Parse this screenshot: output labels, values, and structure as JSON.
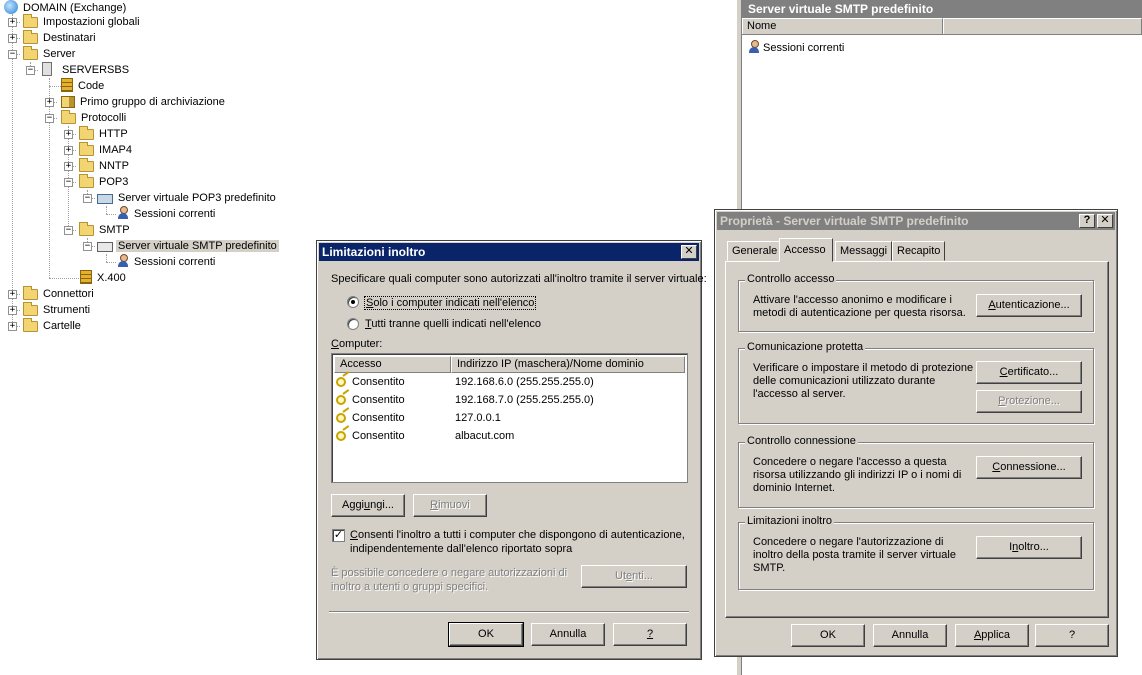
{
  "tree": {
    "root": "DOMAIN (Exchange)",
    "impostazioni": "Impostazioni globali",
    "destinatari": "Destinatari",
    "server": "Server",
    "serversbs": "SERVERSBS",
    "code": "Code",
    "primo_gruppo": "Primo gruppo di archiviazione",
    "protocolli": "Protocolli",
    "http": "HTTP",
    "imap4": "IMAP4",
    "nntp": "NNTP",
    "pop3": "POP3",
    "pop3_vs": "Server virtuale POP3 predefinito",
    "sessioni_pop3": "Sessioni correnti",
    "smtp": "SMTP",
    "smtp_vs": "Server virtuale SMTP predefinito",
    "sessioni_smtp": "Sessioni correnti",
    "x400": "X.400",
    "connettori": "Connettori",
    "strumenti": "Strumenti",
    "cartelle": "Cartelle"
  },
  "right_pane": {
    "title": "Server virtuale SMTP predefinito",
    "col_name": "Nome",
    "item": "Sessioni correnti"
  },
  "relay_dialog": {
    "title": "Limitazioni inoltro",
    "close": "✕",
    "intro": "Specificare quali computer sono autorizzati all'inoltro tramite il server virtuale:",
    "opt_only_pre": "",
    "opt_only_u": "S",
    "opt_only_post": "olo i computer indicati nell'elenco",
    "opt_all_u": "T",
    "opt_all_post": "utti tranne quelli indicati nell'elenco",
    "computer_u": "C",
    "computer_post": "omputer:",
    "col_access": "Accesso",
    "col_ip": "Indirizzo IP (maschera)/Nome dominio",
    "rows": [
      {
        "access": "Consentito",
        "ip": "192.168.6.0 (255.255.255.0)"
      },
      {
        "access": "Consentito",
        "ip": "192.168.7.0 (255.255.255.0)"
      },
      {
        "access": "Consentito",
        "ip": "127.0.0.1"
      },
      {
        "access": "Consentito",
        "ip": "albacut.com"
      }
    ],
    "add_pre": "Aggi",
    "add_u": "u",
    "add_post": "ngi...",
    "remove_u": "R",
    "remove_post": "imuovi",
    "check_mark": "✓",
    "allow_auth_u": "C",
    "allow_auth_post": "onsenti l'inoltro a tutti i computer che dispongono di autenticazione,",
    "allow_auth_line2": "indipendentemente dall'elenco riportato sopra",
    "note_line1": "È possibile concedere o negare autorizzazioni di",
    "note_line2": "inoltro a utenti o gruppi specifici.",
    "users_pre": "Ut",
    "users_u": "e",
    "users_post": "nti...",
    "ok": "OK",
    "cancel": "Annulla",
    "help": "?"
  },
  "props_dialog": {
    "title": "Proprietà - Server virtuale SMTP predefinito",
    "help_btn": "?",
    "close": "✕",
    "tabs": [
      "Generale",
      "Accesso",
      "Messaggi",
      "Recapito"
    ],
    "groups": {
      "access_control": {
        "title": "Controllo accesso",
        "line1": "Attivare l'accesso anonimo e modificare i",
        "line2": "metodi di autenticazione per questa risorsa.",
        "btn_u": "A",
        "btn_post": "utenticazione..."
      },
      "secure_comm": {
        "title": "Comunicazione protetta",
        "line1": "Verificare o impostare il metodo di protezione",
        "line2": "delle comunicazioni utilizzato durante",
        "line3": "l'accesso al server.",
        "cert_u": "C",
        "cert_post": "ertificato...",
        "prot_u": "P",
        "prot_post": "rotezione..."
      },
      "conn_control": {
        "title": "Controllo connessione",
        "line1": "Concedere o negare l'accesso a questa",
        "line2": "risorsa utilizzando gli indirizzi IP o i nomi di",
        "line3": "dominio Internet.",
        "btn_u": "C",
        "btn_post": "onnessione..."
      },
      "relay": {
        "title": "Limitazioni inoltro",
        "line1": "Concedere o negare l'autorizzazione di",
        "line2": "inoltro della posta tramite il server virtuale",
        "line3": "SMTP.",
        "btn_pre": "I",
        "btn_u": "n",
        "btn_post": "oltro..."
      }
    },
    "ok": "OK",
    "cancel": "Annulla",
    "apply_u": "A",
    "apply_post": "pplica",
    "help": "?"
  }
}
